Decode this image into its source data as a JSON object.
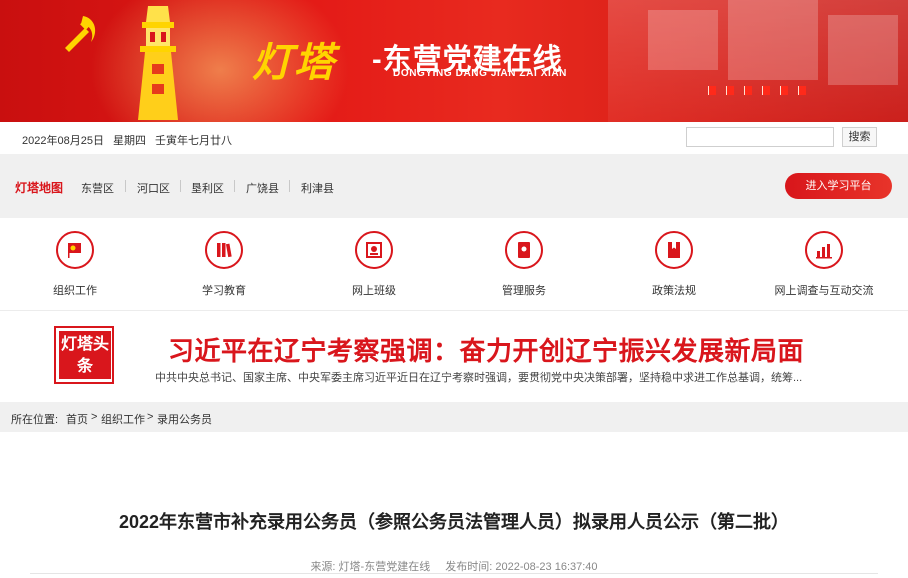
{
  "header": {
    "logo_text": "灯塔",
    "site_title": "-东营党建在线",
    "site_title_en": "DONGYING DANG JIAN ZAI XIAN",
    "colors": {
      "brand_red": "#d9161c",
      "logo_gold": "#ffd400"
    }
  },
  "datebar": {
    "date": "2022年08月25日",
    "weekday": "星期四",
    "lunar": "壬寅年七月廿八",
    "search_placeholder": "",
    "search_button": "搜索"
  },
  "region_nav": {
    "map_label": "灯塔地图",
    "items": [
      "东营区",
      "河口区",
      "垦利区",
      "广饶县",
      "利津县"
    ],
    "study_button": "进入学习平台"
  },
  "services": [
    {
      "label": "组织工作",
      "icon": "party-flag-icon"
    },
    {
      "label": "学习教育",
      "icon": "books-icon"
    },
    {
      "label": "网上班级",
      "icon": "online-class-icon"
    },
    {
      "label": "管理服务",
      "icon": "management-book-icon"
    },
    {
      "label": "政策法规",
      "icon": "policy-bookmark-icon"
    },
    {
      "label": "网上调查与互动交流",
      "icon": "survey-chart-icon"
    }
  ],
  "headline": {
    "badge_text": "灯塔头条",
    "title": "习近平在辽宁考察强调：奋力开创辽宁振兴发展新局面",
    "summary": "中共中央总书记、国家主席、中央军委主席习近平近日在辽宁考察时强调，要贯彻党中央决策部署，坚持稳中求进工作总基调，统筹..."
  },
  "breadcrumb": {
    "prefix": "所在位置:",
    "home": "首页",
    "sep": ">",
    "level1": "组织工作",
    "level2": "录用公务员"
  },
  "article": {
    "title": "2022年东营市补充录用公务员（参照公务员法管理人员）拟录用人员公示（第二批）",
    "source": "来源:  灯塔-东营党建在线",
    "published": "发布时间:  2022-08-23 16:37:40"
  }
}
